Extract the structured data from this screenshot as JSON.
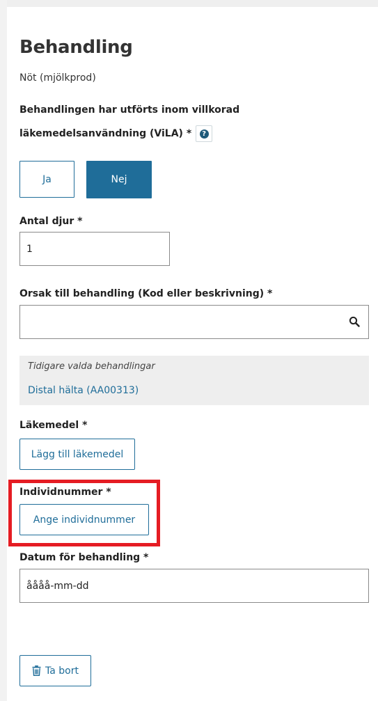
{
  "panel": {
    "title": "Behandling",
    "subtitle": "Nöt (mjölkprod)"
  },
  "vila": {
    "label_line1": "Behandlingen har utförts inom villkorad",
    "label_line2": "läkemedelsanvändning (ViLA) *",
    "help_icon": "question-circle-icon",
    "options": {
      "ja": "Ja",
      "nej": "Nej"
    },
    "selected": "Nej"
  },
  "antal": {
    "label": "Antal djur *",
    "value": "1"
  },
  "orsak": {
    "label": "Orsak till behandling (Kod eller beskrivning) *",
    "value": "",
    "icon": "search-icon"
  },
  "previous": {
    "title": "Tidigare valda behandlingar",
    "items": [
      "Distal hälta (AA00313)"
    ]
  },
  "lakemedel": {
    "label": "Läkemedel *",
    "button": "Lägg till läkemedel"
  },
  "individ": {
    "label": "Individnummer *",
    "button": "Ange individnummer"
  },
  "datum": {
    "label": "Datum för behandling *",
    "value": "åååå-mm-dd"
  },
  "delete": {
    "label": "Ta bort",
    "icon": "trash-icon"
  },
  "colors": {
    "primary": "#1f6d99",
    "highlight": "#e51c23",
    "info_bg": "#eeeeee"
  }
}
